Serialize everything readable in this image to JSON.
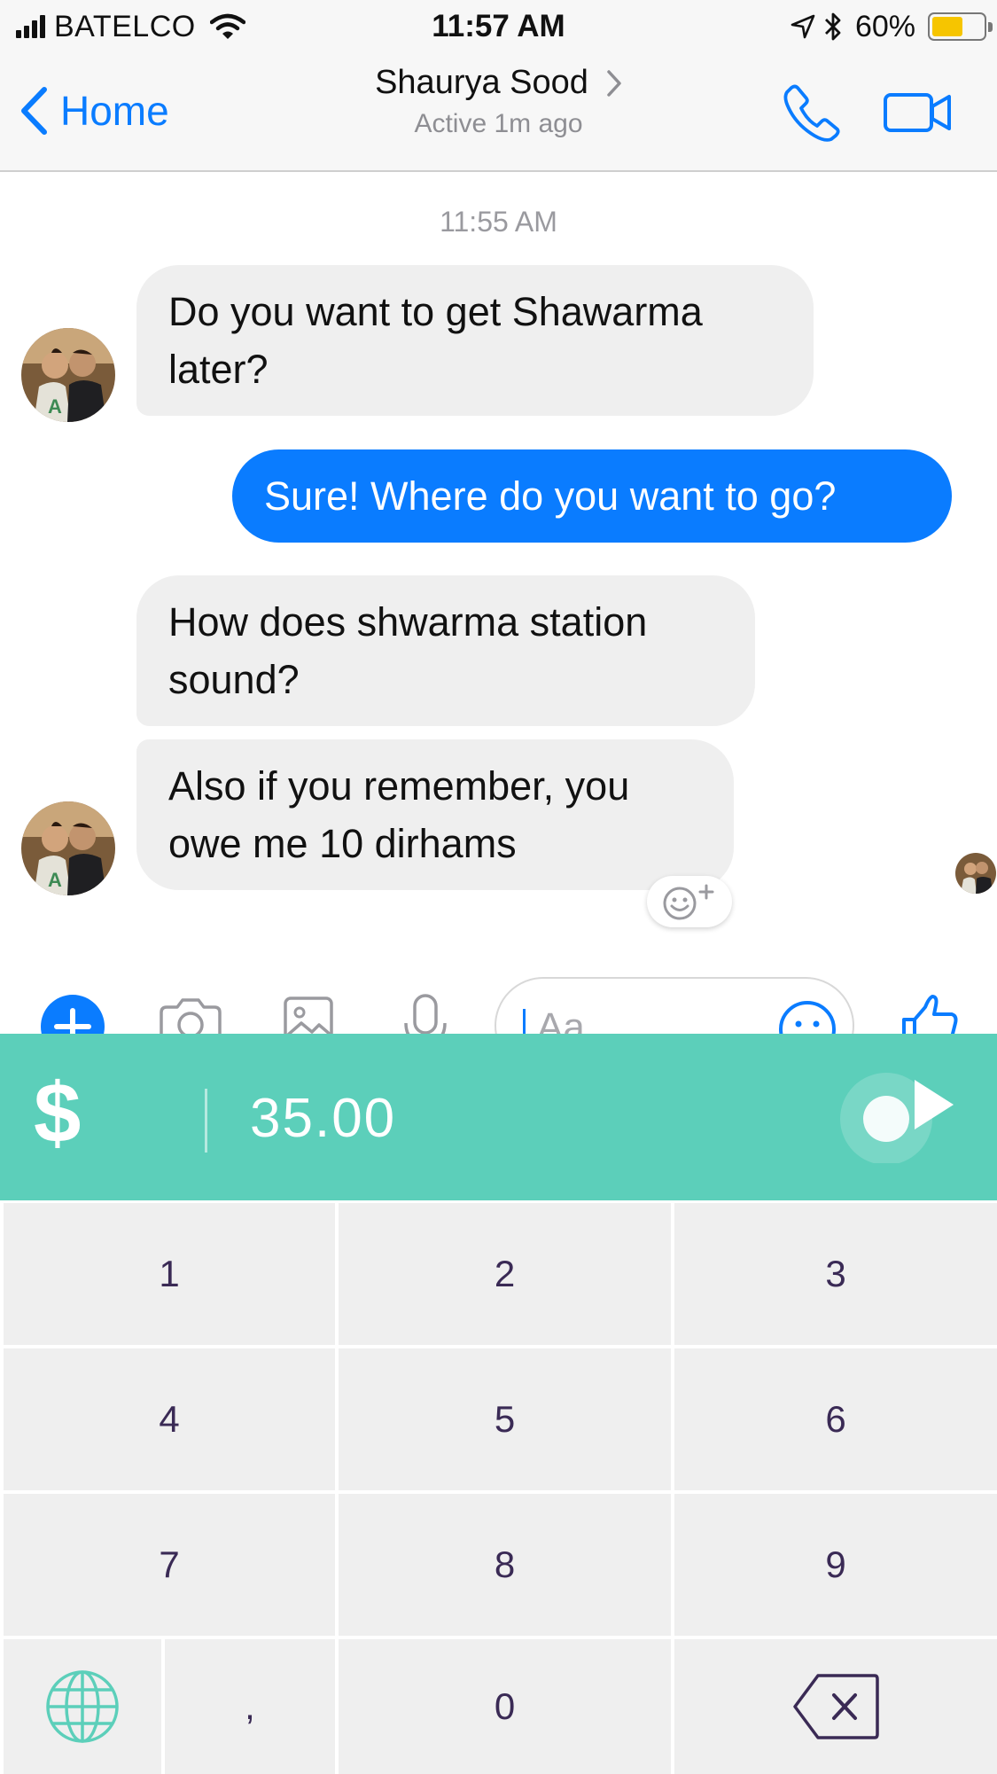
{
  "status_bar": {
    "carrier": "BATELCO",
    "time": "11:57 AM",
    "battery_percent": "60%",
    "battery_level": 0.6,
    "icons": [
      "signal-bars-icon",
      "wifi-icon",
      "location-arrow-icon",
      "bluetooth-icon",
      "battery-icon"
    ]
  },
  "header": {
    "back_label": "Home",
    "contact_name": "Shaurya Sood",
    "contact_status": "Active 1m ago",
    "icons": [
      "chevron-left-icon",
      "chevron-right-icon",
      "phone-icon",
      "video-camera-icon"
    ],
    "accent_color": "#0a7cff"
  },
  "chat": {
    "timestamp": "11:55 AM",
    "messages": [
      {
        "direction": "incoming",
        "text": "Do you want to get Shawarma later?"
      },
      {
        "direction": "outgoing",
        "text": "Sure! Where do you want to go?"
      },
      {
        "direction": "incoming",
        "text": "How does shwarma station sound?"
      },
      {
        "direction": "incoming",
        "text": "Also if you remember, you owe me 10 dirhams"
      }
    ],
    "bubble_colors": {
      "incoming": "#efefef",
      "outgoing": "#0a7cff"
    }
  },
  "composer": {
    "placeholder": "Aa",
    "icons": [
      "plus-icon",
      "camera-icon",
      "image-icon",
      "microphone-icon",
      "emoji-icon",
      "thumbs-up-icon"
    ]
  },
  "payment": {
    "currency_symbol": "$",
    "amount": "35.00",
    "bar_color": "#5ccfba"
  },
  "keypad": {
    "keys": [
      "1",
      "2",
      "3",
      "4",
      "5",
      "6",
      "7",
      "8",
      "9",
      ",",
      "0"
    ],
    "icons": [
      "globe-icon",
      "backspace-icon"
    ]
  }
}
